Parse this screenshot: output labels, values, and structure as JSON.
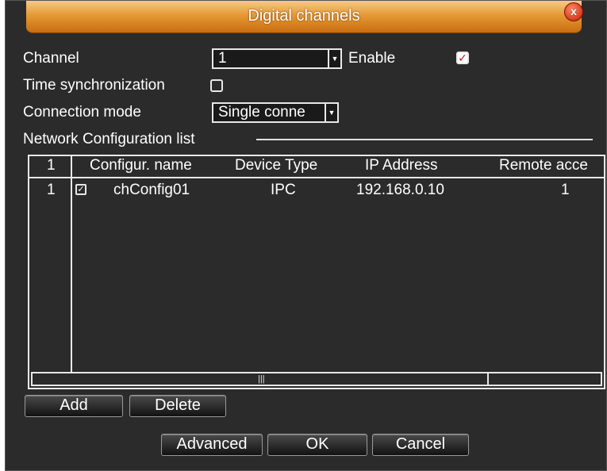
{
  "dialog": {
    "title": "Digital channels",
    "close_label": "x"
  },
  "form": {
    "channel_label": "Channel",
    "channel_value": "1",
    "enable_label": "Enable",
    "enable_checked": true,
    "time_sync_label": "Time synchronization",
    "time_sync_checked": false,
    "connection_mode_label": "Connection mode",
    "connection_mode_value": "Single conne"
  },
  "network_list": {
    "label": "Network Configuration list",
    "columns": [
      "1",
      "Configur. name",
      "Device Type",
      "IP Address",
      "Remote acce"
    ],
    "rows": [
      {
        "index": "1",
        "checked": true,
        "name": "chConfig01",
        "device_type": "IPC",
        "ip": "192.168.0.10",
        "remote": "1"
      }
    ]
  },
  "buttons": {
    "add": "Add",
    "delete": "Delete",
    "advanced": "Advanced",
    "ok": "OK",
    "cancel": "Cancel"
  },
  "colors": {
    "background": "#2b2b2b",
    "title_orange": "#e59a35",
    "check_red": "#d01010"
  }
}
